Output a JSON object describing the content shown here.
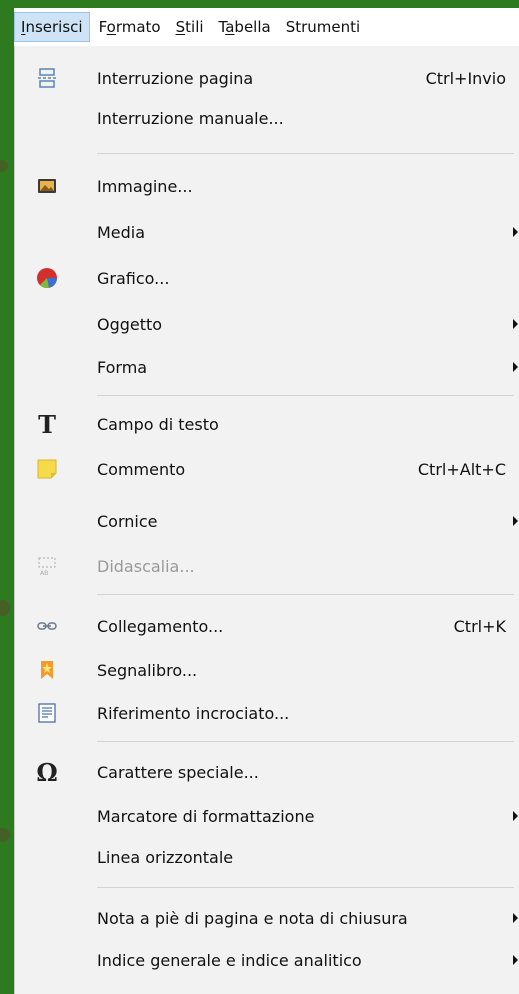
{
  "menubar": {
    "items": [
      {
        "label": "Inserisci",
        "active": true
      },
      {
        "label": "Formato"
      },
      {
        "label": "Stili"
      },
      {
        "label": "Tabella"
      },
      {
        "label": "Strumenti"
      }
    ]
  },
  "menu": {
    "items": [
      {
        "label": "Interruzione pagina",
        "shortcut": "Ctrl+Invio",
        "icon": "page-break-icon"
      },
      {
        "label": "Interruzione manuale...",
        "shortcut": ""
      },
      {
        "label": "Immagine...",
        "shortcut": "",
        "icon": "image-icon"
      },
      {
        "label": "Media",
        "shortcut": "",
        "submenu": true
      },
      {
        "label": "Grafico...",
        "shortcut": "",
        "icon": "chart-icon"
      },
      {
        "label": "Oggetto",
        "shortcut": "",
        "submenu": true
      },
      {
        "label": "Forma",
        "shortcut": "",
        "submenu": true
      },
      {
        "label": "Campo di testo",
        "shortcut": "",
        "icon": "text-box-icon"
      },
      {
        "label": "Commento",
        "shortcut": "Ctrl+Alt+C",
        "icon": "comment-icon"
      },
      {
        "label": "Cornice",
        "shortcut": "",
        "submenu": true
      },
      {
        "label": "Didascalia...",
        "shortcut": "",
        "icon": "caption-icon",
        "disabled": true
      },
      {
        "label": "Collegamento...",
        "shortcut": "Ctrl+K",
        "icon": "hyperlink-icon"
      },
      {
        "label": "Segnalibro...",
        "shortcut": "",
        "icon": "bookmark-icon"
      },
      {
        "label": "Riferimento incrociato...",
        "shortcut": "",
        "icon": "cross-reference-icon"
      },
      {
        "label": "Carattere speciale...",
        "shortcut": "",
        "icon": "omega-icon"
      },
      {
        "label": "Marcatore di formattazione",
        "shortcut": "",
        "submenu": true
      },
      {
        "label": "Linea orizzontale",
        "shortcut": ""
      },
      {
        "label": "Nota a piè di pagina e nota di chiusura",
        "shortcut": "",
        "submenu": true
      },
      {
        "label": "Indice generale e indice analitico",
        "shortcut": "",
        "submenu": true
      }
    ]
  }
}
